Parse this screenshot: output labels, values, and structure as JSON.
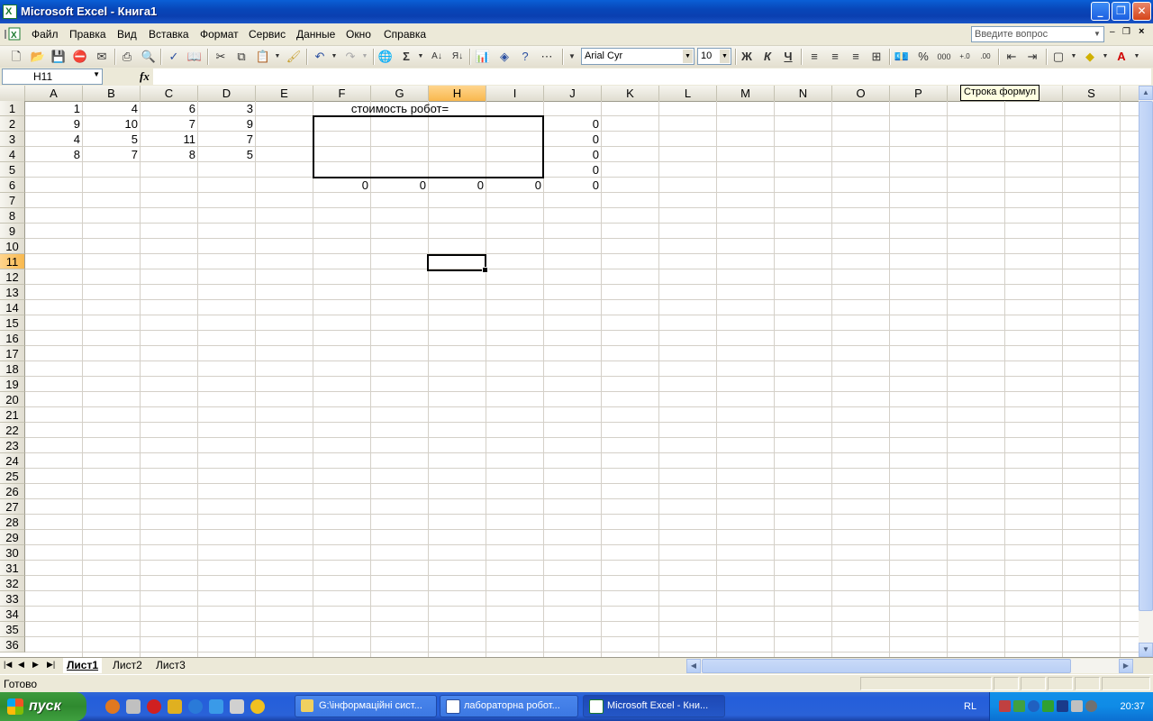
{
  "window": {
    "title": "Microsoft Excel - Книга1"
  },
  "menu": {
    "items": [
      "Файл",
      "Правка",
      "Вид",
      "Вставка",
      "Формат",
      "Сервис",
      "Данные",
      "Окно",
      "Справка"
    ],
    "help_placeholder": "Введите вопрос"
  },
  "toolbar": {
    "font_name": "Arial Cyr",
    "font_size": "10",
    "bold_label": "Ж",
    "italic_label": "К",
    "underline_label": "Ч",
    "percent_label": "%",
    "thousands_label": "000",
    "sum_label": "Σ"
  },
  "formula_bar": {
    "name_box": "H11",
    "fx_label": "fx",
    "formula": "",
    "tooltip": "Строка формул"
  },
  "sheet": {
    "columns": [
      "A",
      "B",
      "C",
      "D",
      "E",
      "F",
      "G",
      "H",
      "I",
      "J",
      "K",
      "L",
      "M",
      "N",
      "O",
      "P",
      "Q",
      "R",
      "S"
    ],
    "rows": [
      "1",
      "2",
      "3",
      "4",
      "5",
      "6",
      "7",
      "8",
      "9",
      "10",
      "11",
      "12",
      "13",
      "14",
      "15",
      "16",
      "17",
      "18",
      "19",
      "20",
      "21",
      "22",
      "23",
      "24",
      "25",
      "26",
      "27",
      "28",
      "29",
      "30",
      "31",
      "32",
      "33",
      "34",
      "35",
      "36"
    ],
    "selected_column": "H",
    "selected_row": "11",
    "cells": {
      "A1": "1",
      "B1": "4",
      "C1": "6",
      "D1": "3",
      "A2": "9",
      "B2": "10",
      "C2": "7",
      "D2": "9",
      "A3": "4",
      "B3": "5",
      "C3": "11",
      "D3": "7",
      "A4": "8",
      "B4": "7",
      "C4": "8",
      "D4": "5",
      "G1": "стоимость робот=",
      "J2": "0",
      "J3": "0",
      "J4": "0",
      "J5": "0",
      "F6": "0",
      "G6": "0",
      "H6": "0",
      "I6": "0",
      "J6": "0"
    }
  },
  "tabs": [
    "Лист1",
    "Лист2",
    "Лист3"
  ],
  "active_tab": "Лист1",
  "status": {
    "text": "Готово"
  },
  "taskbar": {
    "start_label": "пуск",
    "tasks": [
      "G:\\інформаційні сист...",
      "лабораторна робот...",
      "Microsoft Excel - Кни..."
    ],
    "lang": "RL",
    "clock": "20:37"
  }
}
